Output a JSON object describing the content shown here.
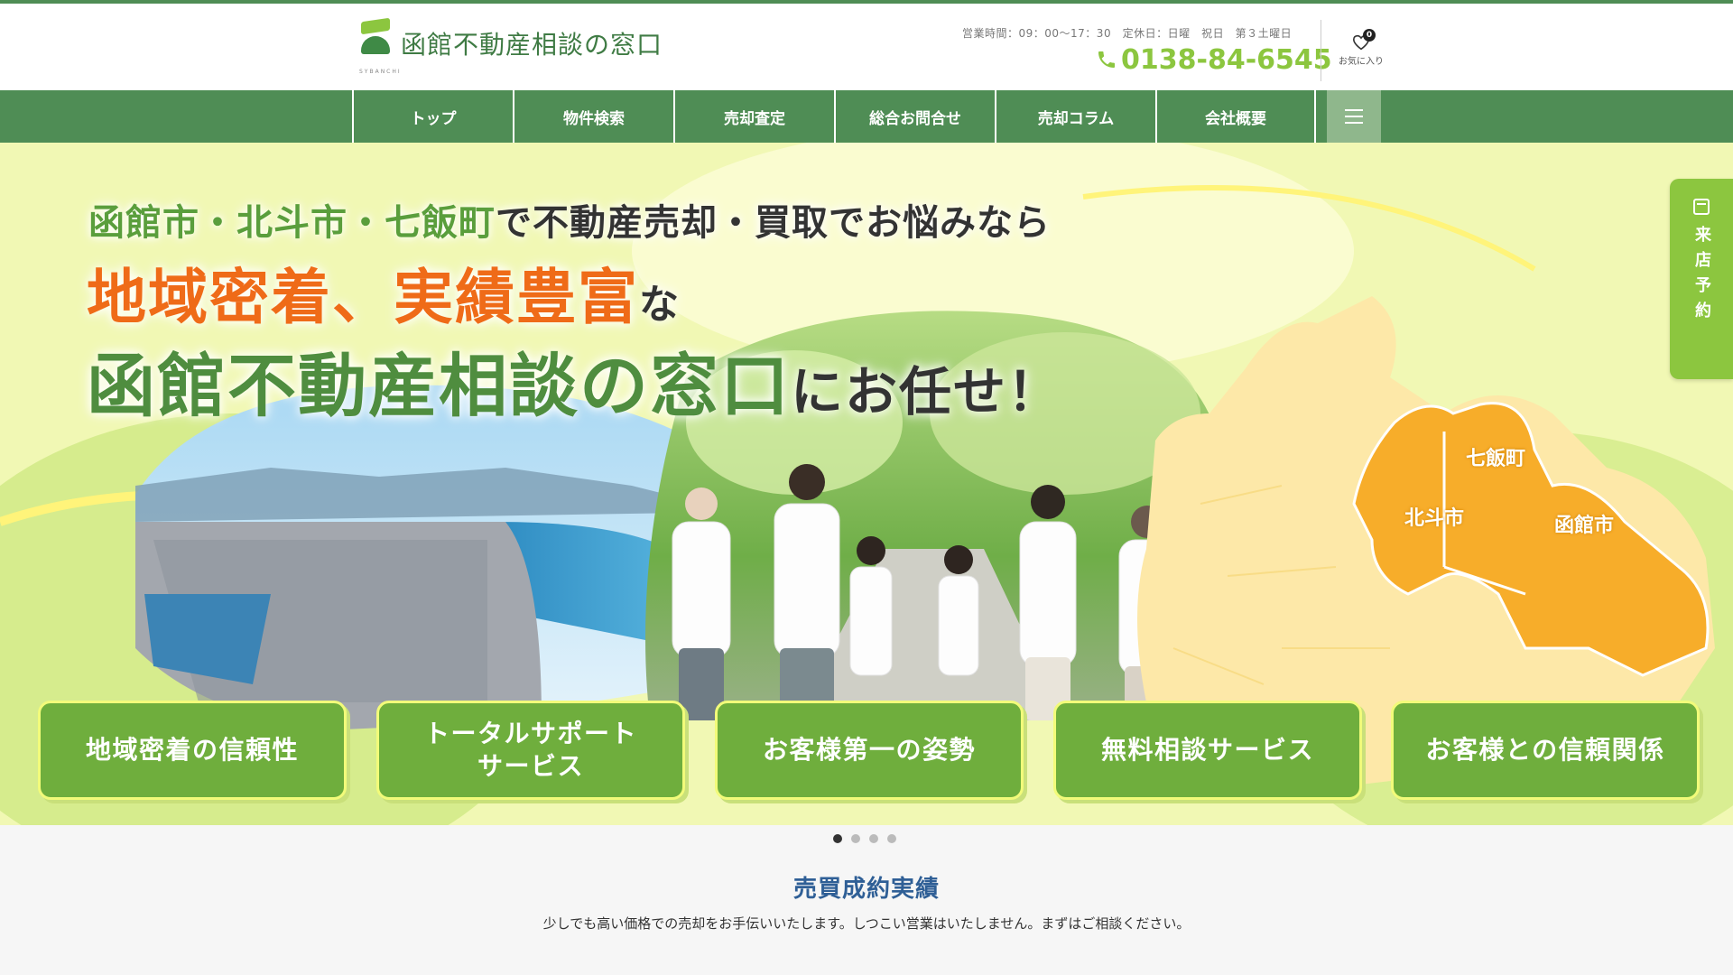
{
  "header": {
    "logo_text": "函館不動産相談の窓口",
    "logo_sub": "SYBANCHI",
    "hours": "営業時間：09：00〜17：30　定休日：日曜　祝日　第３土曜日",
    "phone": "0138-84-6545",
    "favorites_label": "お気に入り",
    "favorites_count": "0"
  },
  "nav": {
    "items": [
      "トップ",
      "物件検索",
      "売却査定",
      "総合お問合せ",
      "売却コラム",
      "会社概要"
    ],
    "menu_icon": "hamburger-icon"
  },
  "hero": {
    "line1_green": "函館市・北斗市・七飯町",
    "line1_rest": "で不動産売却・買取でお悩みなら",
    "line2_orange": "地域密着、実績豊富",
    "line2_rest": "な",
    "line3_green": "函館不動産相談の窓口",
    "line3_rest": "にお任せ！",
    "map_labels": [
      "七飯町",
      "北斗市",
      "函館市"
    ],
    "features": [
      "地域密着の信頼性",
      "トータルサポート\nサービス",
      "お客様第一の姿勢",
      "無料相談サービス",
      "お客様との信頼関係"
    ],
    "reserve_label": "来店予約",
    "slides": 4,
    "active_slide": 1
  },
  "section": {
    "title": "売買成約実績",
    "description": "少しでも高い価格での売却をお手伝いいたします。しつこい営業はいたしません。まずはご相談ください。"
  },
  "colors": {
    "brand_green": "#4f8d55",
    "accent_lime": "#8cc63f",
    "feature_green": "#6fae3d",
    "highlight_orange": "#ef6b18",
    "map_orange": "#f7ad2a"
  }
}
